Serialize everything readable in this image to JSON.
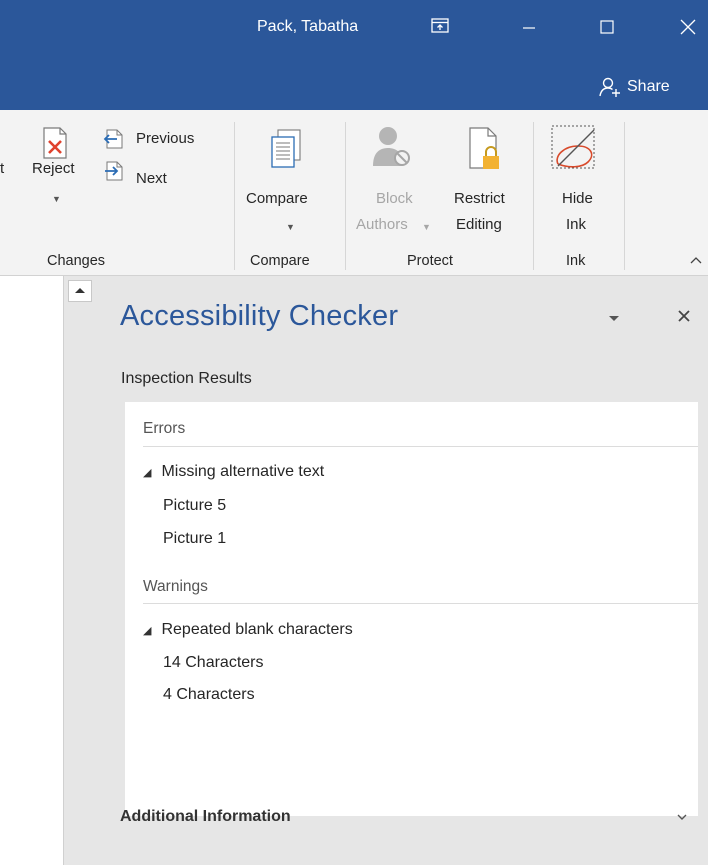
{
  "titlebar": {
    "user_name": "Pack, Tabatha",
    "background": "#2b579a",
    "share_label": "Share"
  },
  "ribbon": {
    "changes": {
      "accept_partial": "t",
      "reject_label": "Reject",
      "previous_label": "Previous",
      "next_label": "Next",
      "group_label": "Changes"
    },
    "compare": {
      "compare_label": "Compare",
      "group_label": "Compare"
    },
    "protect": {
      "block_label_1": "Block",
      "block_label_2": "Authors",
      "restrict_label_1": "Restrict",
      "restrict_label_2": "Editing",
      "group_label": "Protect"
    },
    "ink": {
      "hide_label_1": "Hide",
      "hide_label_2": "Ink",
      "group_label": "Ink"
    }
  },
  "pane": {
    "title": "Accessibility Checker",
    "title_color": "#2b579a",
    "inspection_heading": "Inspection Results",
    "errors_header": "Errors",
    "errors": {
      "group": "Missing alternative text",
      "items": [
        "Picture 5",
        "Picture 1"
      ]
    },
    "warnings_header": "Warnings",
    "warnings": {
      "group": "Repeated blank characters",
      "items": [
        "14 Characters",
        "4 Characters"
      ]
    },
    "additional_info": "Additional Information"
  }
}
